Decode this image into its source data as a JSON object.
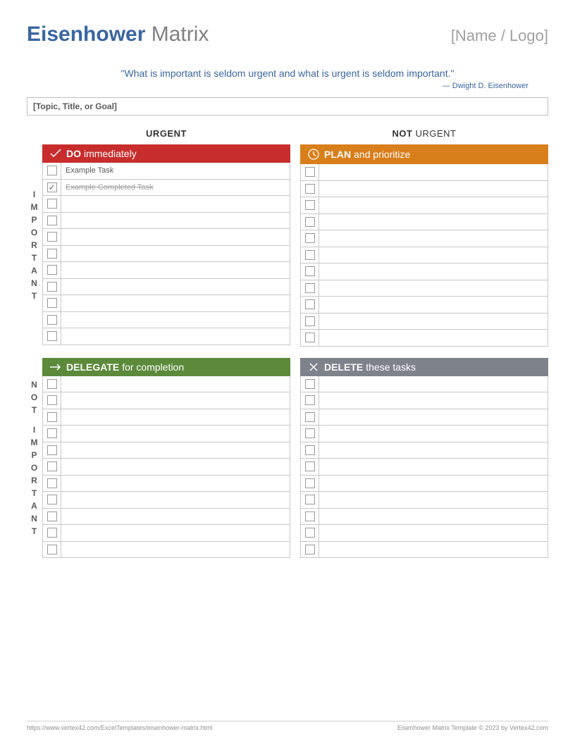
{
  "header": {
    "title_strong": "Eisenhower",
    "title_rest": " Matrix",
    "logo_placeholder": "[Name / Logo]"
  },
  "quote": {
    "text": "\"What is important is seldom urgent and what is urgent is seldom important.\"",
    "attribution": "— Dwight D. Eisenhower"
  },
  "topic_placeholder": "[Topic, Title, or Goal]",
  "columns": {
    "urgent": "URGENT",
    "not_urgent_prefix": "NOT ",
    "not_urgent_rest": "URGENT"
  },
  "rows": {
    "important": "IMPORTANT",
    "not_important_prefix": "NOT",
    "not_important_rest": "IMPORTANT"
  },
  "quads": {
    "do": {
      "strong": "DO",
      "rest": "immediately"
    },
    "plan": {
      "strong": "PLAN",
      "rest": "and prioritize"
    },
    "delegate": {
      "strong": "DELEGATE",
      "rest": "for completion"
    },
    "delete": {
      "strong": "DELETE",
      "rest": "these tasks"
    }
  },
  "tasks": {
    "do": [
      {
        "text": "Example Task",
        "done": false
      },
      {
        "text": "Example Completed Task",
        "done": true
      },
      {},
      {},
      {},
      {},
      {},
      {},
      {},
      {},
      {}
    ],
    "plan": [
      {},
      {},
      {},
      {},
      {},
      {},
      {},
      {},
      {},
      {},
      {}
    ],
    "delegate": [
      {},
      {},
      {},
      {},
      {},
      {},
      {},
      {},
      {},
      {},
      {}
    ],
    "delete": [
      {},
      {},
      {},
      {},
      {},
      {},
      {},
      {},
      {},
      {},
      {}
    ]
  },
  "footer": {
    "url": "https://www.vertex42.com/ExcelTemplates/eisenhower-matrix.html",
    "copyright": "Eisenhower Matrix Template © 2023 by Vertex42.com"
  }
}
